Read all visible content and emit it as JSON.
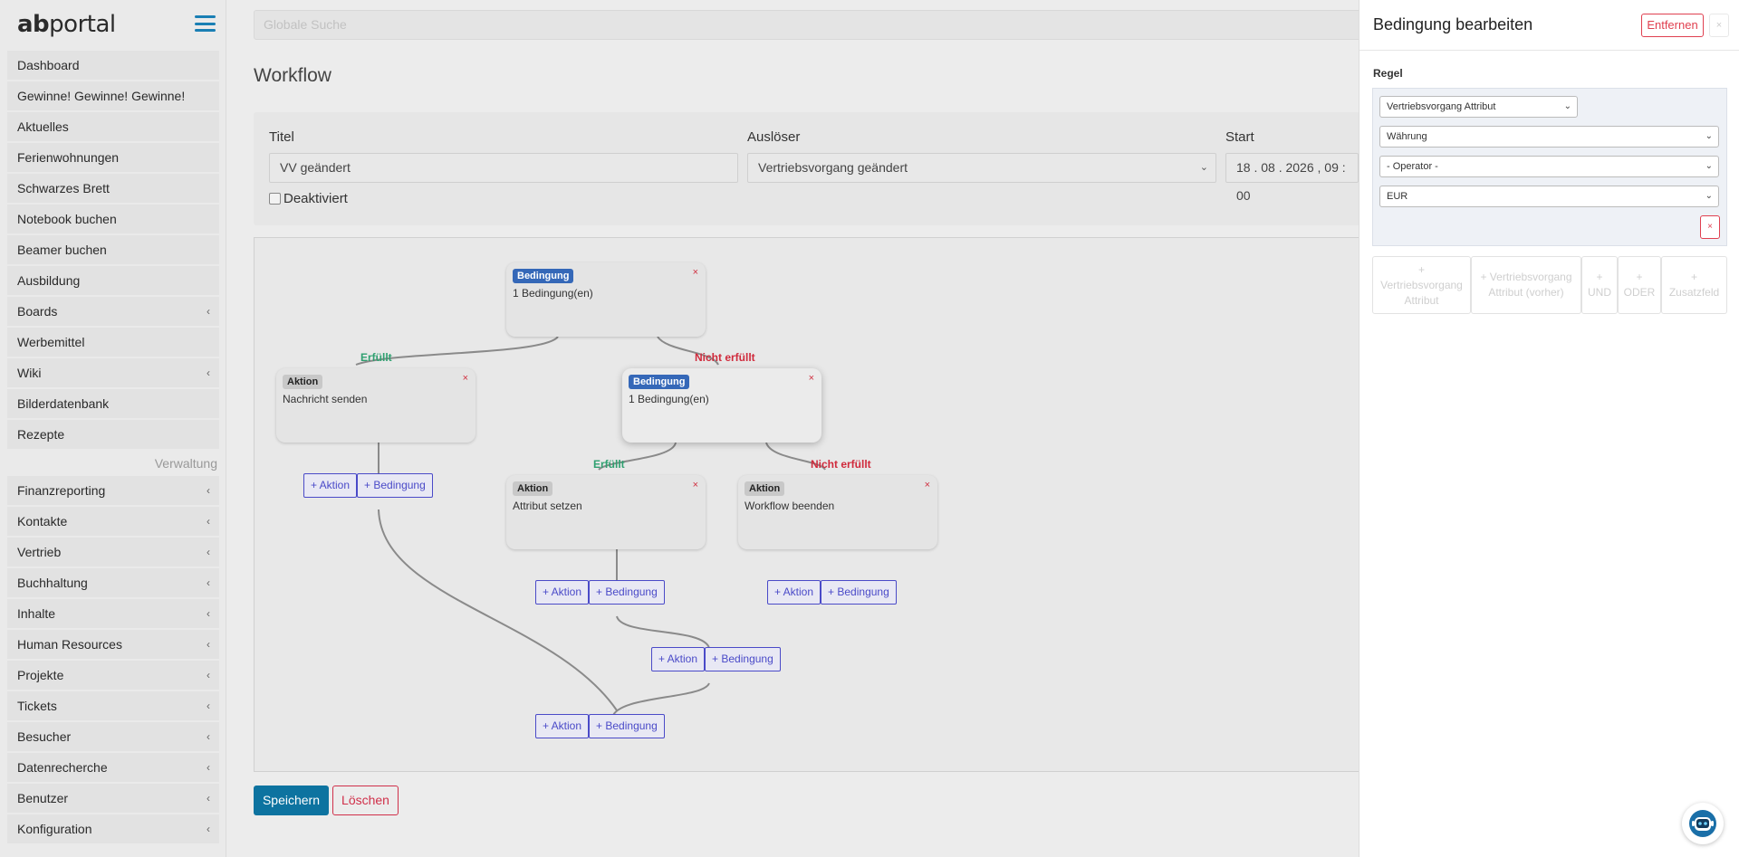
{
  "app": {
    "logo_prefix": "ab",
    "logo_suffix": "portal"
  },
  "sidebar": {
    "items": [
      {
        "label": "Dashboard",
        "chevron": ""
      },
      {
        "label": "Gewinne! Gewinne! Gewinne!",
        "chevron": ""
      },
      {
        "label": "Aktuelles",
        "chevron": ""
      },
      {
        "label": "Ferienwohnungen",
        "chevron": ""
      },
      {
        "label": "Schwarzes Brett",
        "chevron": ""
      },
      {
        "label": "Notebook buchen",
        "chevron": ""
      },
      {
        "label": "Beamer buchen",
        "chevron": ""
      },
      {
        "label": "Ausbildung",
        "chevron": ""
      },
      {
        "label": "Boards",
        "chevron": "‹"
      },
      {
        "label": "Werbemittel",
        "chevron": ""
      },
      {
        "label": "Wiki",
        "chevron": "‹"
      },
      {
        "label": "Bilderdatenbank",
        "chevron": ""
      },
      {
        "label": "Rezepte",
        "chevron": ""
      }
    ],
    "section_label": "Verwaltung",
    "admin_items": [
      {
        "label": "Finanzreporting",
        "chevron": "‹"
      },
      {
        "label": "Kontakte",
        "chevron": "‹"
      },
      {
        "label": "Vertrieb",
        "chevron": "‹"
      },
      {
        "label": "Buchhaltung",
        "chevron": "‹"
      },
      {
        "label": "Inhalte",
        "chevron": "‹"
      },
      {
        "label": "Human Resources",
        "chevron": "‹"
      },
      {
        "label": "Projekte",
        "chevron": "‹"
      },
      {
        "label": "Tickets",
        "chevron": "‹"
      },
      {
        "label": "Besucher",
        "chevron": "‹"
      },
      {
        "label": "Datenrecherche",
        "chevron": "‹"
      },
      {
        "label": "Benutzer",
        "chevron": "‹"
      },
      {
        "label": "Konfiguration",
        "chevron": "‹"
      }
    ]
  },
  "search": {
    "placeholder": "Globale Suche"
  },
  "page": {
    "title": "Workflow"
  },
  "form": {
    "titel_label": "Titel",
    "titel_value": "VV geändert",
    "ausloeser_label": "Auslöser",
    "ausloeser_value": "Vertriebsvorgang geändert",
    "start_label": "Start",
    "start_value": "18 . 08 . 2026 ,  09 : 00",
    "deaktiviert_label": "Deaktiviert"
  },
  "workflow": {
    "nodes": {
      "cond_root": {
        "badge": "Bedingung",
        "text": "1 Bedingung(en)",
        "close": "×"
      },
      "act_send": {
        "badge": "Aktion",
        "text": "Nachricht senden",
        "close": "×"
      },
      "cond_inner": {
        "badge": "Bedingung",
        "text": "1 Bedingung(en)",
        "close": "×"
      },
      "act_attr": {
        "badge": "Aktion",
        "text": "Attribut setzen",
        "close": "×"
      },
      "act_end": {
        "badge": "Aktion",
        "text": "Workflow beenden",
        "close": "×"
      }
    },
    "edge_labels": {
      "ok1": "Erfüllt",
      "no1": "Nicht erfüllt",
      "ok2": "Erfüllt",
      "no2": "Nicht erfüllt"
    },
    "add_action": "+ Aktion",
    "add_condition": "+ Bedingung"
  },
  "footer": {
    "save": "Speichern",
    "delete": "Löschen"
  },
  "panel": {
    "title": "Bedingung bearbeiten",
    "remove": "Entfernen",
    "close": "×",
    "rule_label": "Regel",
    "selects": {
      "source": "Vertriebsvorgang Attribut",
      "attribute": "Währung",
      "operator": "- Operator -",
      "value": "EUR"
    },
    "rule_remove": "×",
    "add_buttons": [
      "+ Vertriebsvorgang Attribut",
      "+ Vertriebsvorgang Attribut (vorher)",
      "+ UND",
      "+ ODER",
      "+ Zusatzfeld"
    ]
  },
  "colors": {
    "primary": "#0d73a0",
    "danger": "#d0304a",
    "condition_badge": "#3568b8",
    "fulfilled": "#2fa070",
    "not_fulfilled": "#d02a3c",
    "add_button": "#4a4ac8"
  },
  "icons": {
    "menu": "hamburger-icon",
    "chatbot": "robot-icon"
  }
}
